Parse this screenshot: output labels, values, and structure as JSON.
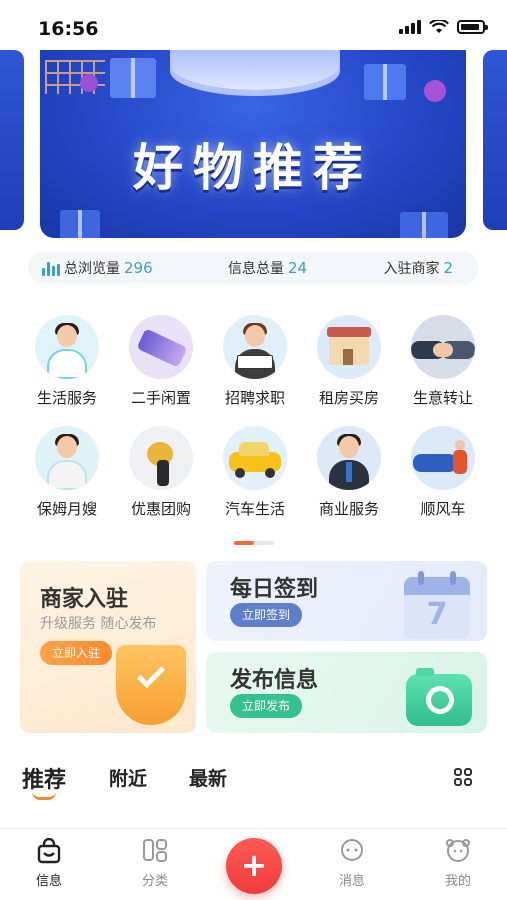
{
  "status_bar": {
    "time": "16:56"
  },
  "banner": {
    "title": "好物推荐"
  },
  "stats": [
    {
      "label": "总浏览量",
      "value": "296"
    },
    {
      "label": "信息总量",
      "value": "24"
    },
    {
      "label": "入驻商家",
      "value": "2"
    }
  ],
  "categories": [
    {
      "label": "生活服务",
      "icon": "housekeeper-icon"
    },
    {
      "label": "二手闲置",
      "icon": "phone-icon"
    },
    {
      "label": "招聘求职",
      "icon": "job-seeker-icon"
    },
    {
      "label": "租房买房",
      "icon": "house-icon"
    },
    {
      "label": "生意转让",
      "icon": "handshake-icon"
    },
    {
      "label": "保姆月嫂",
      "icon": "nanny-icon"
    },
    {
      "label": "优惠团购",
      "icon": "group-buy-icon"
    },
    {
      "label": "汽车生活",
      "icon": "car-icon"
    },
    {
      "label": "商业服务",
      "icon": "businessman-icon"
    },
    {
      "label": "顺风车",
      "icon": "rideshare-icon"
    }
  ],
  "cards": {
    "merchant": {
      "title": "商家入驻",
      "subtitle": "升级服务 随心发布",
      "button": "立即入驻"
    },
    "checkin": {
      "title": "每日签到",
      "button": "立即签到",
      "calendar_day": "7"
    },
    "publish": {
      "title": "发布信息",
      "button": "立即发布"
    }
  },
  "tabs": [
    {
      "label": "推荐",
      "active": true
    },
    {
      "label": "附近",
      "active": false
    },
    {
      "label": "最新",
      "active": false
    }
  ],
  "bottom_nav": {
    "items": [
      {
        "label": "信息",
        "active": true
      },
      {
        "label": "分类",
        "active": false
      },
      {
        "label": "消息",
        "active": false
      },
      {
        "label": "我的",
        "active": false
      }
    ],
    "fab_symbol": "+"
  },
  "colors": {
    "accent": "#3aa3b5",
    "fab": "#f23b3b",
    "tab_underline": "#f08a2a"
  }
}
